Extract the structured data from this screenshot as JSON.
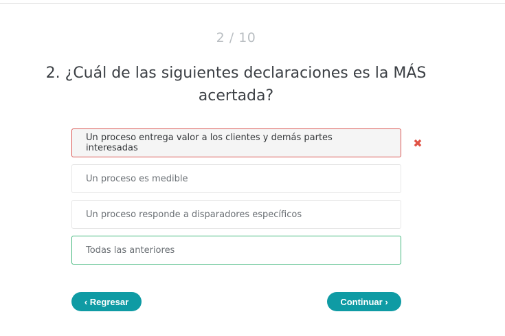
{
  "quiz": {
    "progress": "2 / 10",
    "question": "2. ¿Cuál de las siguientes declaraciones es la MÁS acertada?",
    "options": [
      {
        "label": "Un proceso entrega valor a los clientes y demás partes interesadas",
        "state": "incorrect-selected"
      },
      {
        "label": "Un proceso es medible",
        "state": "neutral"
      },
      {
        "label": "Un proceso responde a disparadores específicos",
        "state": "neutral"
      },
      {
        "label": "Todas las anteriores",
        "state": "correct"
      }
    ],
    "wrong_mark": "✖"
  },
  "nav": {
    "back_label": "‹ Regresar",
    "next_label": "Continuar ›"
  },
  "colors": {
    "accent": "#0f9ba4",
    "error": "#d9534f",
    "success": "#3fb67a"
  }
}
